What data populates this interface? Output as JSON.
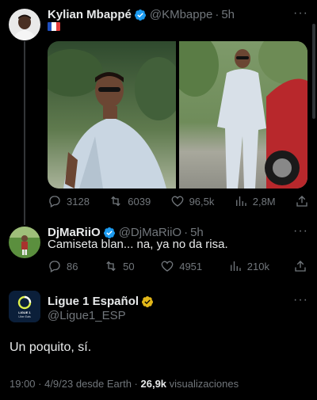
{
  "main_tweet": {
    "name": "Kylian Mbappé",
    "handle": "@KMbappe",
    "time": "5h",
    "country_flag": "france-flag",
    "stats": {
      "replies": "3128",
      "retweets": "6039",
      "likes": "96,5k",
      "views": "2,8M"
    }
  },
  "reply": {
    "name": "DjMaRiiO",
    "handle": "@DjMaRiiO",
    "time": "5h",
    "text": "Camiseta blan... na, ya no da risa.",
    "stats": {
      "replies": "86",
      "retweets": "50",
      "likes": "4951",
      "views": "210k"
    }
  },
  "focus_tweet": {
    "name": "Ligue 1 Español",
    "handle": "@Ligue1_ESP",
    "avatar_text": "LIGUE 1",
    "avatar_subtext": "Uber Eats",
    "text": "Un poquito, sí.",
    "meta_time": "19:00 · 4/9/23 desde Earth · ",
    "meta_views": "26,9k",
    "meta_views_label": " visualizaciones"
  },
  "colors": {
    "background": "#000000",
    "verified_blue": "#1d9bf0",
    "verified_gold": "#e2b719",
    "muted": "#71767b"
  }
}
